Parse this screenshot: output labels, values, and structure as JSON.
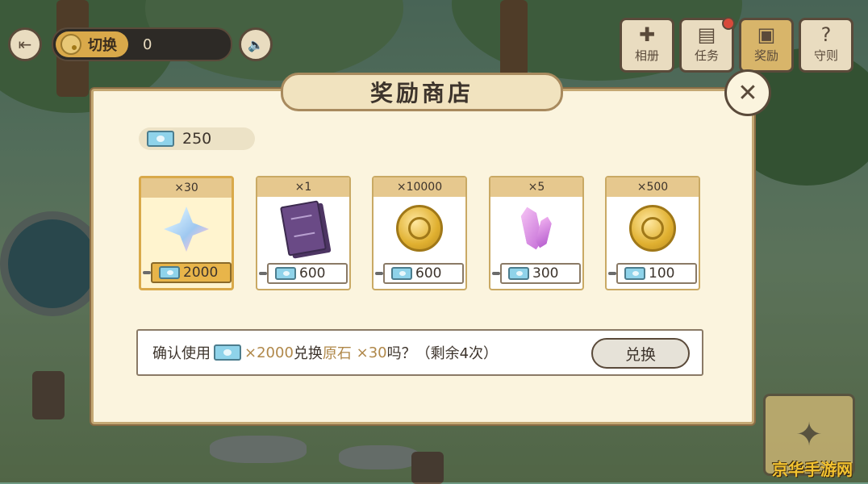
{
  "topbar": {
    "switch_label": "切换",
    "currency_value": "0"
  },
  "menu": [
    {
      "label": "相册",
      "icon": "puzzle-icon"
    },
    {
      "label": "任务",
      "icon": "task-book-icon"
    },
    {
      "label": "奖励",
      "icon": "gift-basket-icon"
    },
    {
      "label": "守则",
      "icon": "question-icon"
    }
  ],
  "dialog": {
    "title": "奖励商店",
    "balance": "250",
    "items": [
      {
        "qty": "×30",
        "price": "2000",
        "graphic": "primogem-star",
        "selected": true
      },
      {
        "qty": "×1",
        "price": "600",
        "graphic": "purple-book",
        "selected": false
      },
      {
        "qty": "×10000",
        "price": "600",
        "graphic": "mora-coin",
        "selected": false
      },
      {
        "qty": "×5",
        "price": "300",
        "graphic": "purple-crystal",
        "selected": false
      },
      {
        "qty": "×500",
        "price": "100",
        "graphic": "mora-coin",
        "selected": false
      }
    ],
    "confirm": {
      "prefix": "确认使用",
      "cost": "×2000",
      "middle": "兑换",
      "item_name": "原石",
      "item_qty": " ×30",
      "suffix": "吗？（剩余4次）"
    },
    "exchange_label": "兑换"
  },
  "watermark": "京华手游网",
  "colors": {
    "panel_bg": "#fbf4de",
    "accent_gold": "#d9a94a",
    "highlight_text": "#b0884a"
  }
}
